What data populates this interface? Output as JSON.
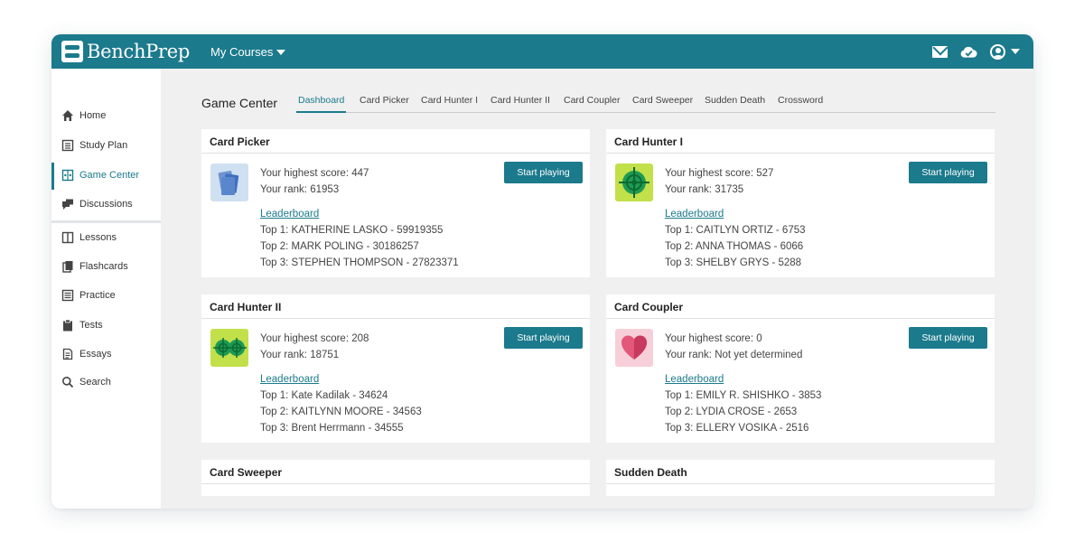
{
  "brand": {
    "name": "BenchPrep",
    "accent": "#1b7a8c"
  },
  "header": {
    "courses_label": "My Courses",
    "icons": [
      "mail-icon",
      "cloud-check-icon",
      "user-icon"
    ]
  },
  "sidebar": {
    "items": [
      {
        "label": "Home",
        "icon": "home-icon"
      },
      {
        "label": "Study Plan",
        "icon": "calendar-icon"
      },
      {
        "label": "Game Center",
        "icon": "game-center-icon"
      },
      {
        "label": "Discussions",
        "icon": "chat-icon"
      },
      {
        "label": "Lessons",
        "icon": "book-icon"
      },
      {
        "label": "Flashcards",
        "icon": "flashcards-icon"
      },
      {
        "label": "Practice",
        "icon": "list-icon"
      },
      {
        "label": "Tests",
        "icon": "clipboard-icon"
      },
      {
        "label": "Essays",
        "icon": "document-icon"
      },
      {
        "label": "Search",
        "icon": "search-icon"
      }
    ],
    "active": "Game Center"
  },
  "main": {
    "title": "Game Center",
    "tabs": [
      "Dashboard",
      "Card Picker",
      "Card Hunter I",
      "Card Hunter II",
      "Card Coupler",
      "Card Sweeper",
      "Sudden Death",
      "Crossword"
    ],
    "active_tab": "Dashboard",
    "cards": [
      {
        "title": "Card Picker",
        "icon": "card-picker-icon",
        "score": "Your highest score: 447",
        "rank": "Your rank: 61953",
        "leaderboard": "Leaderboard",
        "top": [
          "Top 1: KATHERINE LASKO - 59919355",
          "Top 2: MARK POLING - 30186257",
          "Top 3: STEPHEN THOMPSON - 27823371"
        ],
        "button": "Start playing"
      },
      {
        "title": "Card Hunter I",
        "icon": "target-icon",
        "score": "Your highest score: 527",
        "rank": "Your rank: 31735",
        "leaderboard": "Leaderboard",
        "top": [
          "Top 1: CAITLYN ORTIZ - 6753",
          "Top 2: ANNA THOMAS - 6066",
          "Top 3: SHELBY GRYS - 5288"
        ],
        "button": "Start playing"
      },
      {
        "title": "Card Hunter II",
        "icon": "double-target-icon",
        "score": "Your highest score: 208",
        "rank": "Your rank: 18751",
        "leaderboard": "Leaderboard",
        "top": [
          "Top 1: Kate Kadilak - 34624",
          "Top 2: KAITLYNN MOORE - 34563",
          "Top 3: Brent Herrmann - 34555"
        ],
        "button": "Start playing"
      },
      {
        "title": "Card Coupler",
        "icon": "heart-icon",
        "score": "Your highest score: 0",
        "rank": "Your rank: Not yet determined",
        "leaderboard": "Leaderboard",
        "top": [
          "Top 1: EMILY R. SHISHKO - 3853",
          "Top 2: LYDIA CROSE - 2653",
          "Top 3: ELLERY VOSIKA - 2516"
        ],
        "button": "Start playing"
      },
      {
        "title": "Card Sweeper"
      },
      {
        "title": "Sudden Death"
      }
    ]
  }
}
